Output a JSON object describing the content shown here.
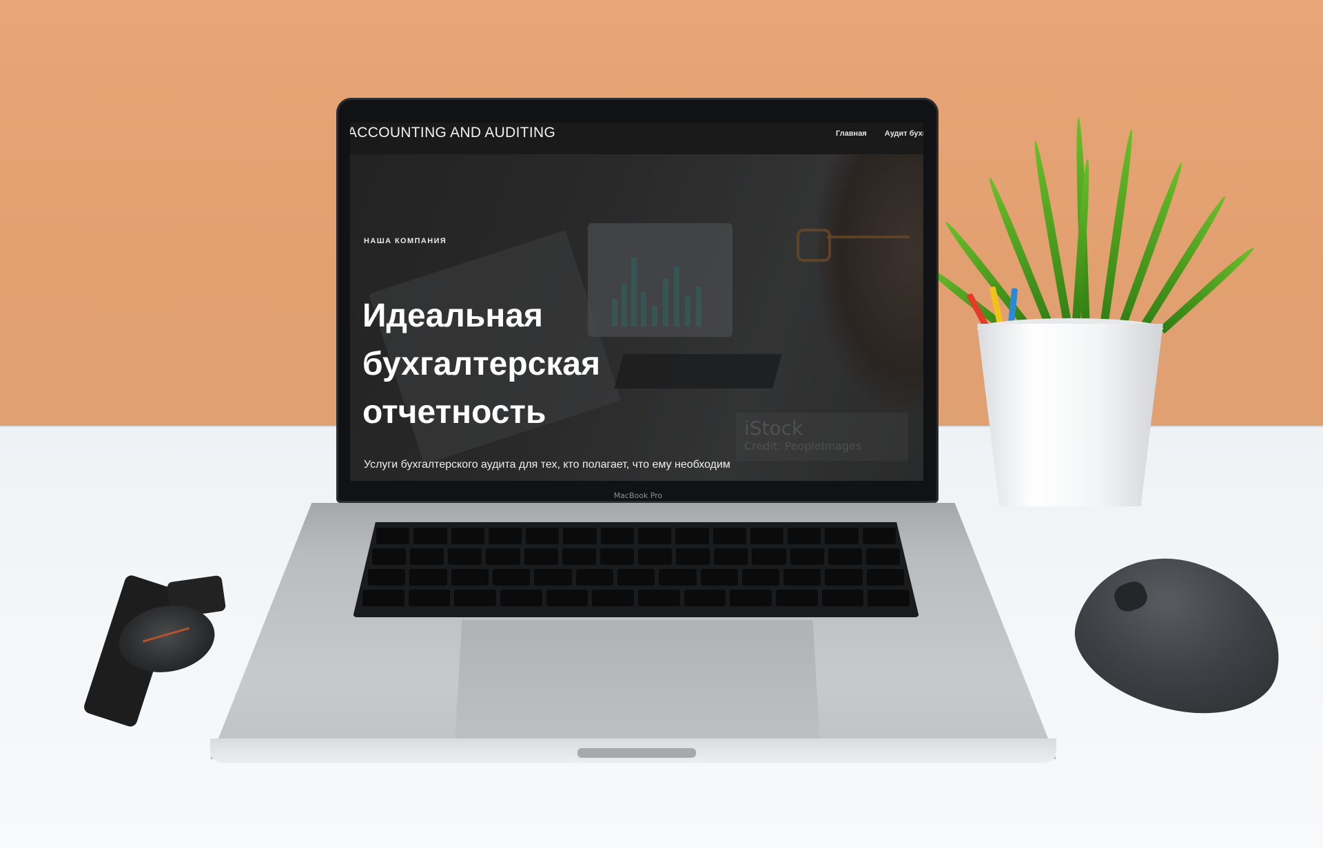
{
  "site": {
    "logo": "ACCOUNTING AND AUDITING",
    "nav": [
      {
        "label": "Главная"
      },
      {
        "label": "Аудит бухг"
      }
    ]
  },
  "hero": {
    "eyebrow": "НАША КОМПАНИЯ",
    "headline_lines": [
      "Идеальная",
      "бухгалтерская",
      "отчетность"
    ],
    "subline": "Услуги бухгалтерского аудита для тех, кто полагает, что ему необходим",
    "watermark_brand": "iStock",
    "watermark_credit": "Credit: PeopleImages"
  },
  "device": {
    "label": "MacBook Pro"
  },
  "colors": {
    "wall": "#e3a071",
    "desk": "#f3f6f8",
    "header_bg": "#1a1a1a",
    "hero_text": "#ffffff"
  }
}
